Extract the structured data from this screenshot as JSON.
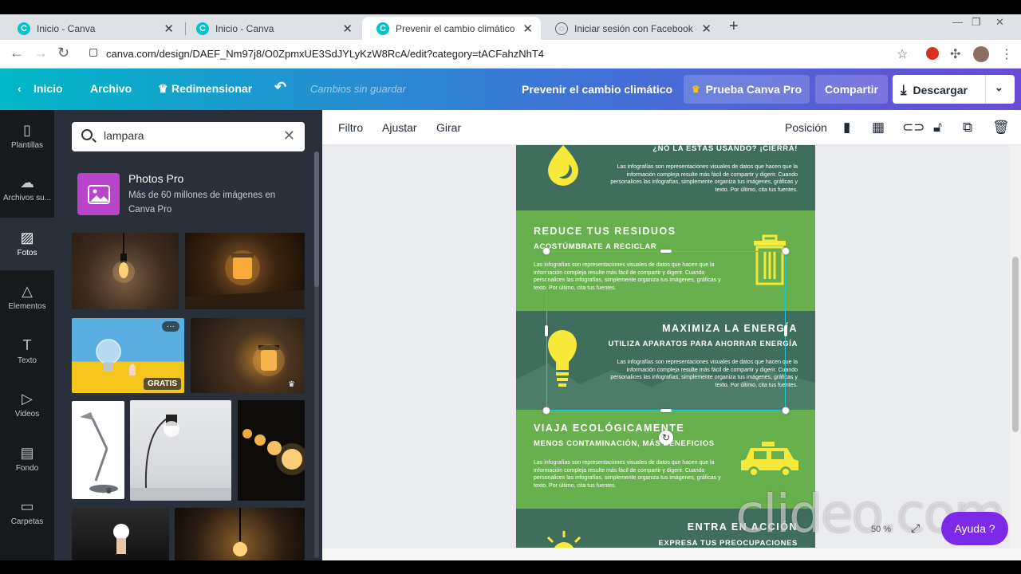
{
  "browser": {
    "tabs": [
      {
        "title": "Inicio - Canva",
        "active": false
      },
      {
        "title": "Inicio - Canva",
        "active": false
      },
      {
        "title": "Prevenir el cambio climático - Inf",
        "active": true
      },
      {
        "title": "Iniciar sesión con Facebook - Zoo",
        "active": false
      }
    ],
    "url": "canva.com/design/DAEF_Nm97j8/O0ZpmxUE3SdJYLyKzW8RcA/edit?category=tACFahzNhT4",
    "extension_badge": "1"
  },
  "header": {
    "home": "Inicio",
    "file": "Archivo",
    "resize": "Redimensionar",
    "unsaved": "Cambios sin guardar",
    "doc_title": "Prevenir el cambio climático",
    "pro_button": "Prueba Canva Pro",
    "share": "Compartir",
    "download": "Descargar"
  },
  "rail": [
    {
      "label": "Plantillas",
      "icon": "templates-icon",
      "glyph": "▯"
    },
    {
      "label": "Archivos su...",
      "icon": "upload-icon",
      "glyph": "☁"
    },
    {
      "label": "Fotos",
      "icon": "photos-icon",
      "glyph": "▨"
    },
    {
      "label": "Elementos",
      "icon": "elements-icon",
      "glyph": "△"
    },
    {
      "label": "Texto",
      "icon": "text-icon",
      "glyph": "T"
    },
    {
      "label": "Videos",
      "icon": "videos-icon",
      "glyph": "▷"
    },
    {
      "label": "Fondo",
      "icon": "background-icon",
      "glyph": "▤"
    },
    {
      "label": "Carpetas",
      "icon": "folders-icon",
      "glyph": "▭"
    }
  ],
  "panel": {
    "search_value": "lampara",
    "pro_title": "Photos Pro",
    "pro_desc": "Más de 60 millones de imágenes en Canva Pro",
    "free_badge": "GRATIS",
    "more": "···"
  },
  "toolbar": {
    "filter": "Filtro",
    "adjust": "Ajustar",
    "flip": "Girar",
    "position": "Posición"
  },
  "poster": {
    "top_heading": "¿NO LA ESTÁS USANDO? ¡CIERRA!",
    "body": "Las infografías son representaciones visuales de datos que hacen que la información compleja resulte más fácil de compartir y digerir. Cuando personalices las infografías, simplemente organiza tus imágenes, gráficas y texto. Por último, cita tus fuentes.",
    "sections": [
      {
        "title": "REDUCE TUS RESIDUOS",
        "subtitle": "ACOSTÚMBRATE A RECICLAR"
      },
      {
        "title": "MAXIMIZA LA ENERGÍA",
        "subtitle": "UTILIZA APARATOS PARA AHORRAR ENERGÍA"
      },
      {
        "title": "VIAJA ECOLÓGICAMENTE",
        "subtitle": "MENOS CONTAMINACIÓN, MÁS BENEFICIOS"
      },
      {
        "title": "ENTRA EN ACCIÓN",
        "subtitle": "EXPRESA TUS PREOCUPACIONES"
      }
    ],
    "colors": {
      "dark": "#3f6e5c",
      "light": "#68b04d",
      "accent": "#f7e93a"
    }
  },
  "footer": {
    "zoom": "50 %",
    "help": "Ayuda ?",
    "watermark": "clideo.com"
  }
}
